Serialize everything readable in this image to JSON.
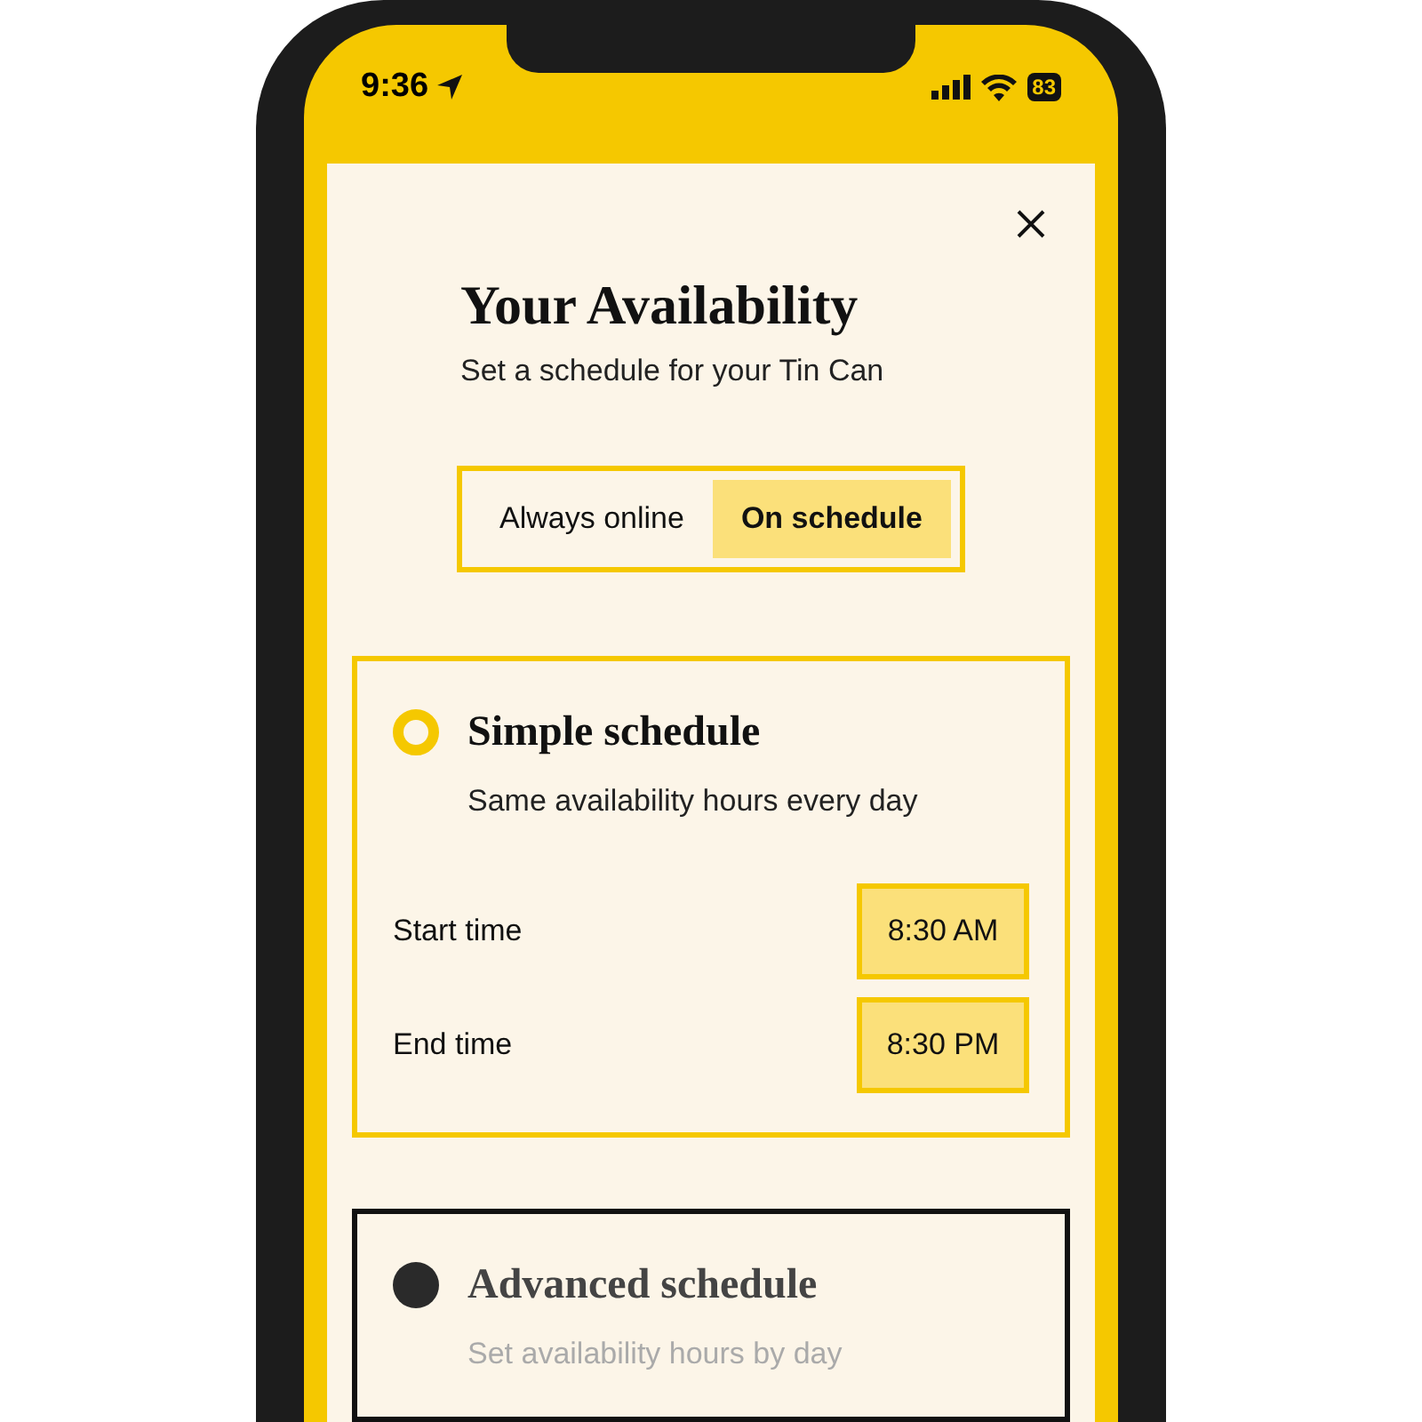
{
  "status_bar": {
    "time": "9:36",
    "battery": "83"
  },
  "dialog": {
    "title": "Your Availability",
    "subtitle": "Set a schedule for your Tin Can"
  },
  "mode_options": [
    {
      "label": "Always online",
      "selected": false
    },
    {
      "label": "On schedule",
      "selected": true
    }
  ],
  "schedules": [
    {
      "title": "Simple schedule",
      "description": "Same availability hours every day",
      "selected": true,
      "times": [
        {
          "label": "Start time",
          "value": "8:30 AM"
        },
        {
          "label": "End time",
          "value": "8:30 PM"
        }
      ]
    },
    {
      "title": "Advanced schedule",
      "description": "Set availability hours by day",
      "selected": false
    }
  ]
}
